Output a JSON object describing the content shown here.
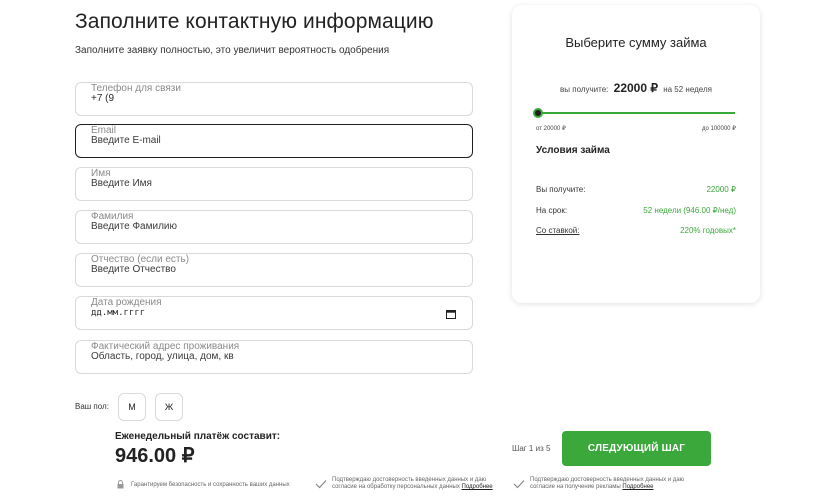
{
  "form": {
    "title": "Заполните контактную информацию",
    "subtitle": "Заполните заявку полностью, это увеличит вероятность одобрения",
    "fields": [
      {
        "label": "Телефон для связи",
        "value": "+7 (9"
      },
      {
        "label": "Email",
        "value": "Введите E-mail"
      },
      {
        "label": "Имя",
        "value": "Введите Имя"
      },
      {
        "label": "Фамилия",
        "value": "Введите Фамилию"
      },
      {
        "label": "Отчество (если есть)",
        "value": "Введите Отчество"
      },
      {
        "label": "Дата рождения",
        "value": "дд.мм.гггг"
      },
      {
        "label": "Фактический адрес проживания",
        "value": "Область, город, улица, дом, кв"
      }
    ],
    "gender": {
      "label": "Ваш пол:",
      "male": "М",
      "female": "Ж"
    }
  },
  "payment": {
    "title": "Еженедельный платёж составит:",
    "amount": "946.00 ₽"
  },
  "navigation": {
    "step": "Шаг 1 из 5",
    "next_label": "СЛЕДУЮЩИЙ ШАГ"
  },
  "footer": {
    "security": "Гарантируем безопасность и сохранность ваших данных",
    "consent1_text": "Подтверждаю достоверность введенных данных и даю согласие на обработку персональных данных",
    "consent1_link": "Подробнее",
    "consent2_text": "Подтверждаю достоверность введенных данных и даю согласие на получение рекламы",
    "consent2_link": "Подробнее"
  },
  "loan": {
    "title": "Выберите сумму займа",
    "get_prefix": "вы получите:",
    "amount": "22000 ₽",
    "term_suffix": "на 52 неделя",
    "slider_fraction": 0.0,
    "range_min": "от 20000 ₽",
    "range_max": "до 100000 ₽",
    "terms_title": "Условия займа",
    "terms": [
      {
        "label": "Вы получите:",
        "value": "22000 ₽"
      },
      {
        "label": "На срок:",
        "value": "52 недели (946.00 ₽/нед)"
      },
      {
        "label": "Со ставкой:",
        "value": "220% годовых*"
      }
    ],
    "accent_color": "#3aa83a"
  }
}
